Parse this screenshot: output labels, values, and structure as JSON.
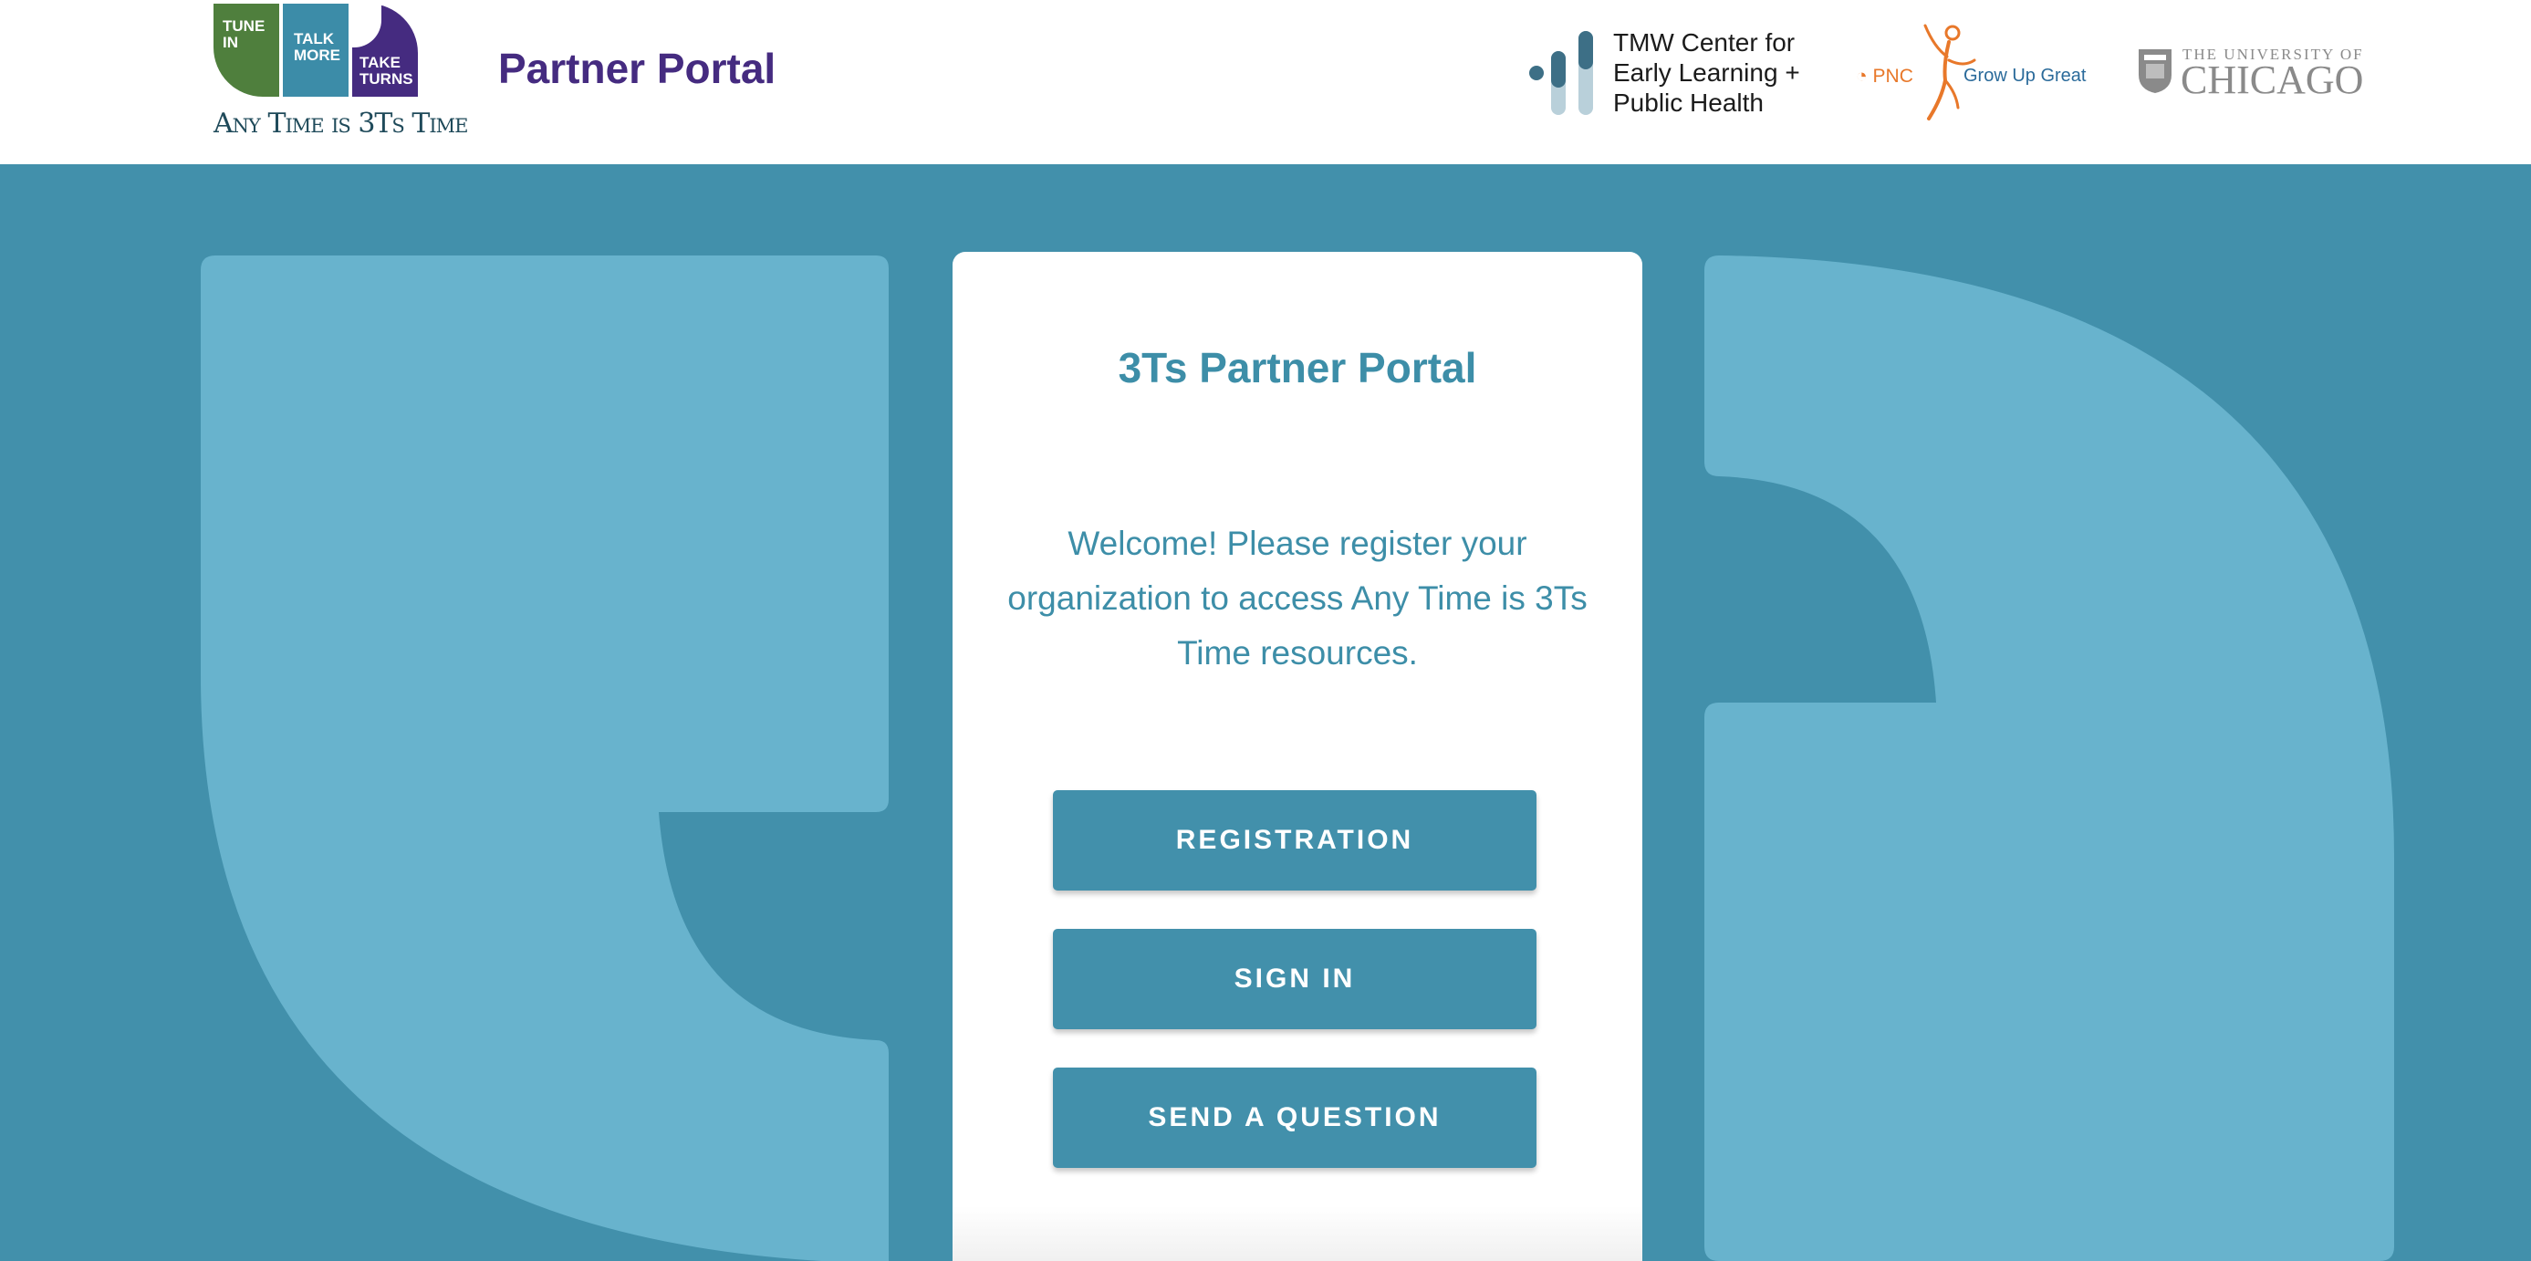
{
  "header": {
    "logo": {
      "tile_tune": "TUNE IN",
      "tile_talk": "TALK MORE",
      "tile_take": "TAKE TURNS",
      "tagline": "Any Time is 3Ts Time"
    },
    "portal_title": "Partner Portal",
    "partners": {
      "tmw": "TMW Center for\nEarly Learning +\nPublic Health",
      "pnc_mark": "PNC",
      "pnc_text": "Grow Up Great",
      "uchicago_line1": "THE UNIVERSITY OF",
      "uchicago_line2": "CHICAGO"
    }
  },
  "card": {
    "title": "3Ts Partner Portal",
    "welcome": "Welcome! Please register your organization to access Any Time is 3Ts Time resources.",
    "buttons": {
      "registration": "REGISTRATION",
      "sign_in": "SIGN IN",
      "send_question": "SEND A QUESTION"
    }
  },
  "colors": {
    "background": "#4290ab",
    "shape": "#68b3cd",
    "brand_purple": "#452b80",
    "brand_green": "#4f7f3d",
    "brand_teal": "#3c8ca8",
    "button": "#4290ab"
  }
}
